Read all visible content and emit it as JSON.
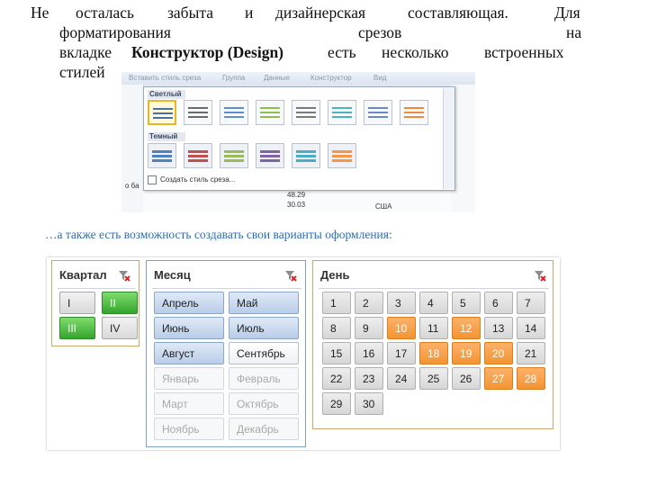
{
  "paragraph": {
    "l1_w1": "Не",
    "l1_w2": "осталась",
    "l1_w3": "забыта",
    "l1_w4": "и",
    "l1_w5": "дизайнерская",
    "l1_w6": "составляющая.",
    "l1_w7": "Для",
    "l2_w1": "форматирования",
    "l2_w2": "срезов",
    "l2_w3": "на",
    "l3_a": "вкладке",
    "l3_bold": "Конструктор (Design)",
    "l3_b": "есть",
    "l3_c": "несколько",
    "l3_d": "встроенных",
    "l4": "стилей"
  },
  "style_gallery": {
    "light_label": "Светлый",
    "dark_label": "Темный",
    "create_style": "Создать стиль среза...",
    "ribbon_tabs": [
      "Вставить стиль среза",
      "Группа",
      "Данные",
      "Конструктор",
      "Вид"
    ],
    "light_colors": [
      "#4a6fa5",
      "#6b6b6b",
      "#5b8fd0",
      "#8cbf4c",
      "#7a7a7a",
      "#4cb3c5",
      "#6d88c9",
      "#f08a3a",
      "#707070",
      "#5b7fb8"
    ],
    "dark_colors": [
      "#4f81bd",
      "#c0504d",
      "#9bbb59",
      "#8064a2",
      "#4bacc6",
      "#f79646"
    ],
    "bottom_values": [
      "48.29",
      "30.03"
    ],
    "bottom_partial": "о ба",
    "bottom_label": "США"
  },
  "caption": "…а также есть возможность создавать свои варианты оформления:",
  "slicers": {
    "quarter": {
      "title": "Квартал",
      "items": [
        {
          "label": "I",
          "state": "normal"
        },
        {
          "label": "II",
          "state": "selected"
        },
        {
          "label": "III",
          "state": "selected"
        },
        {
          "label": "IV",
          "state": "normal"
        }
      ]
    },
    "month": {
      "title": "Месяц",
      "items": [
        {
          "label": "Апрель",
          "state": "selected"
        },
        {
          "label": "Май",
          "state": "selected"
        },
        {
          "label": "Июнь",
          "state": "selected"
        },
        {
          "label": "Июль",
          "state": "selected"
        },
        {
          "label": "Август",
          "state": "selected"
        },
        {
          "label": "Сентябрь",
          "state": "normal"
        },
        {
          "label": "Январь",
          "state": "disabled"
        },
        {
          "label": "Февраль",
          "state": "disabled"
        },
        {
          "label": "Март",
          "state": "disabled"
        },
        {
          "label": "Октябрь",
          "state": "disabled"
        },
        {
          "label": "Ноябрь",
          "state": "disabled"
        },
        {
          "label": "Декабрь",
          "state": "disabled"
        }
      ]
    },
    "day": {
      "title": "День",
      "items": [
        "1",
        "2",
        "3",
        "4",
        "5",
        "6",
        "7",
        "8",
        "9",
        "10",
        "11",
        "12",
        "13",
        "14",
        "15",
        "16",
        "17",
        "18",
        "19",
        "20",
        "21",
        "22",
        "23",
        "24",
        "25",
        "26",
        "27",
        "28",
        "29",
        "30"
      ],
      "selected": [
        "10",
        "12",
        "18",
        "19",
        "20",
        "27",
        "28"
      ]
    }
  }
}
